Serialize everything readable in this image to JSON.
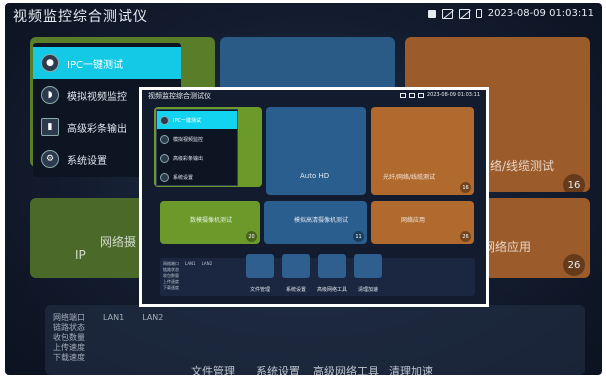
{
  "app": {
    "title": "视频监控综合测试仪",
    "datetime": "2023-08-09 01:03:11"
  },
  "status_icons": [
    "lock-icon",
    "no-signal-icon",
    "no-network-icon",
    "battery-icon"
  ],
  "background_menu": [
    {
      "label": "IPC一键测试",
      "icon": "ipc-icon",
      "active": true
    },
    {
      "label": "模拟视频监控",
      "icon": "bell-camera-icon",
      "active": false
    },
    {
      "label": "高级彩条输出",
      "icon": "color-bars-icon",
      "active": false
    },
    {
      "label": "系统设置",
      "icon": "gear-icon",
      "active": false
    }
  ],
  "background_tiles": {
    "cable_test_label": "络/线缆测试",
    "cable_test_count": "16",
    "network_app_label": "网络应用",
    "network_app_count": "26",
    "ip_label": "IP",
    "network_label_left": "网络摄"
  },
  "background_net": {
    "headers": [
      "网络端口",
      "LAN1",
      "LAN2"
    ],
    "rows": [
      "链路状态",
      "收包数量",
      "上传速度",
      "下载速度"
    ]
  },
  "background_toolbar": [
    "文件管理",
    "系统设置",
    "高级网络工具",
    "清理加速"
  ],
  "overlay": {
    "title": "视频监控综合测试仪",
    "datetime": "2023-08-09 01:03:11",
    "menu": [
      {
        "label": "IPC一键测试",
        "active": true
      },
      {
        "label": "模拟视频监控",
        "active": false
      },
      {
        "label": "高级彩条输出",
        "active": false
      },
      {
        "label": "系统设置",
        "active": false
      }
    ],
    "tiles": {
      "auto_hd_label": "Auto HD",
      "cable_label": "光纤/网络/线缆测试",
      "cable_count": "16",
      "analog_camera_label": "数模摄像机测试",
      "analog_camera_count": "20",
      "hd_camera_label": "模拟高清摄像机测试",
      "hd_camera_count": "11",
      "network_app_label": "网络应用",
      "network_app_count": "26"
    },
    "net": {
      "headers": [
        "网络端口",
        "LAN1",
        "LAN2"
      ],
      "rows": [
        "链路状态",
        "收包数量",
        "上传速度",
        "下载速度"
      ]
    },
    "toolbar": [
      "文件管理",
      "系统设置",
      "高级网络工具",
      "清理加速"
    ]
  }
}
